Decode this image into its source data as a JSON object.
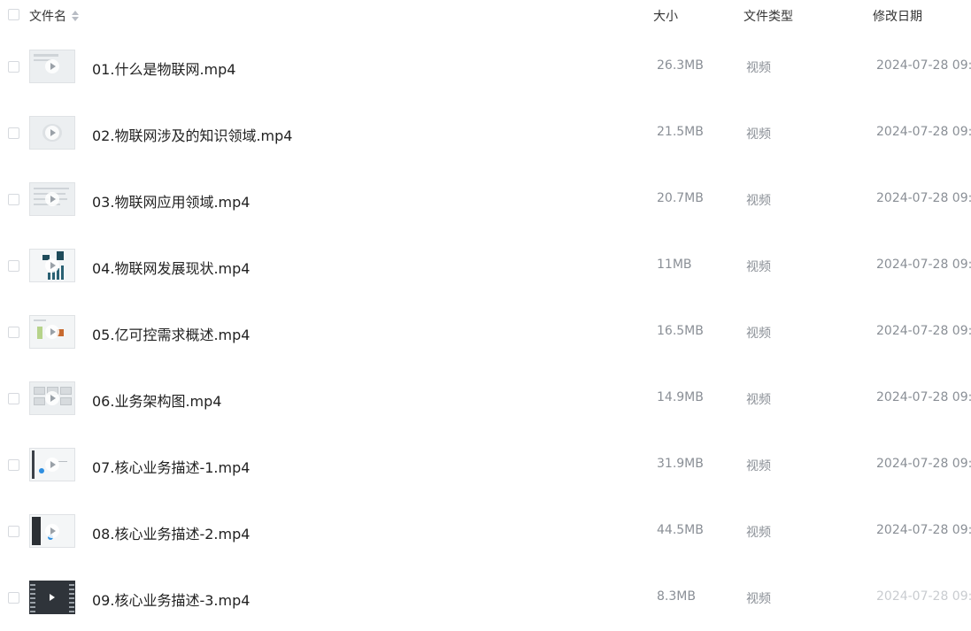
{
  "header": {
    "name": "文件名",
    "size": "大小",
    "type": "文件类型",
    "date": "修改日期"
  },
  "files": [
    {
      "name": "01.什么是物联网.mp4",
      "size": "26.3MB",
      "type": "视频",
      "date": "2024-07-28 09:",
      "thumb": "slide"
    },
    {
      "name": "02.物联网涉及的知识领域.mp4",
      "size": "21.5MB",
      "type": "视频",
      "date": "2024-07-28 09:",
      "thumb": "slide"
    },
    {
      "name": "03.物联网应用领域.mp4",
      "size": "20.7MB",
      "type": "视频",
      "date": "2024-07-28 09:",
      "thumb": "slide"
    },
    {
      "name": "04.物联网发展现状.mp4",
      "size": "11MB",
      "type": "视频",
      "date": "2024-07-28 09:",
      "thumb": "chart"
    },
    {
      "name": "05.亿可控需求概述.mp4",
      "size": "16.5MB",
      "type": "视频",
      "date": "2024-07-28 09:",
      "thumb": "diagram"
    },
    {
      "name": "06.业务架构图.mp4",
      "size": "14.9MB",
      "type": "视频",
      "date": "2024-07-28 09:",
      "thumb": "grid"
    },
    {
      "name": "07.核心业务描述-1.mp4",
      "size": "31.9MB",
      "type": "视频",
      "date": "2024-07-28 09:",
      "thumb": "flow"
    },
    {
      "name": "08.核心业务描述-2.mp4",
      "size": "44.5MB",
      "type": "视频",
      "date": "2024-07-28 09:",
      "thumb": "flow-dark"
    },
    {
      "name": "09.核心业务描述-3.mp4",
      "size": "8.3MB",
      "type": "视频",
      "date": "2024-07-28 09:",
      "thumb": "video-icon"
    }
  ]
}
